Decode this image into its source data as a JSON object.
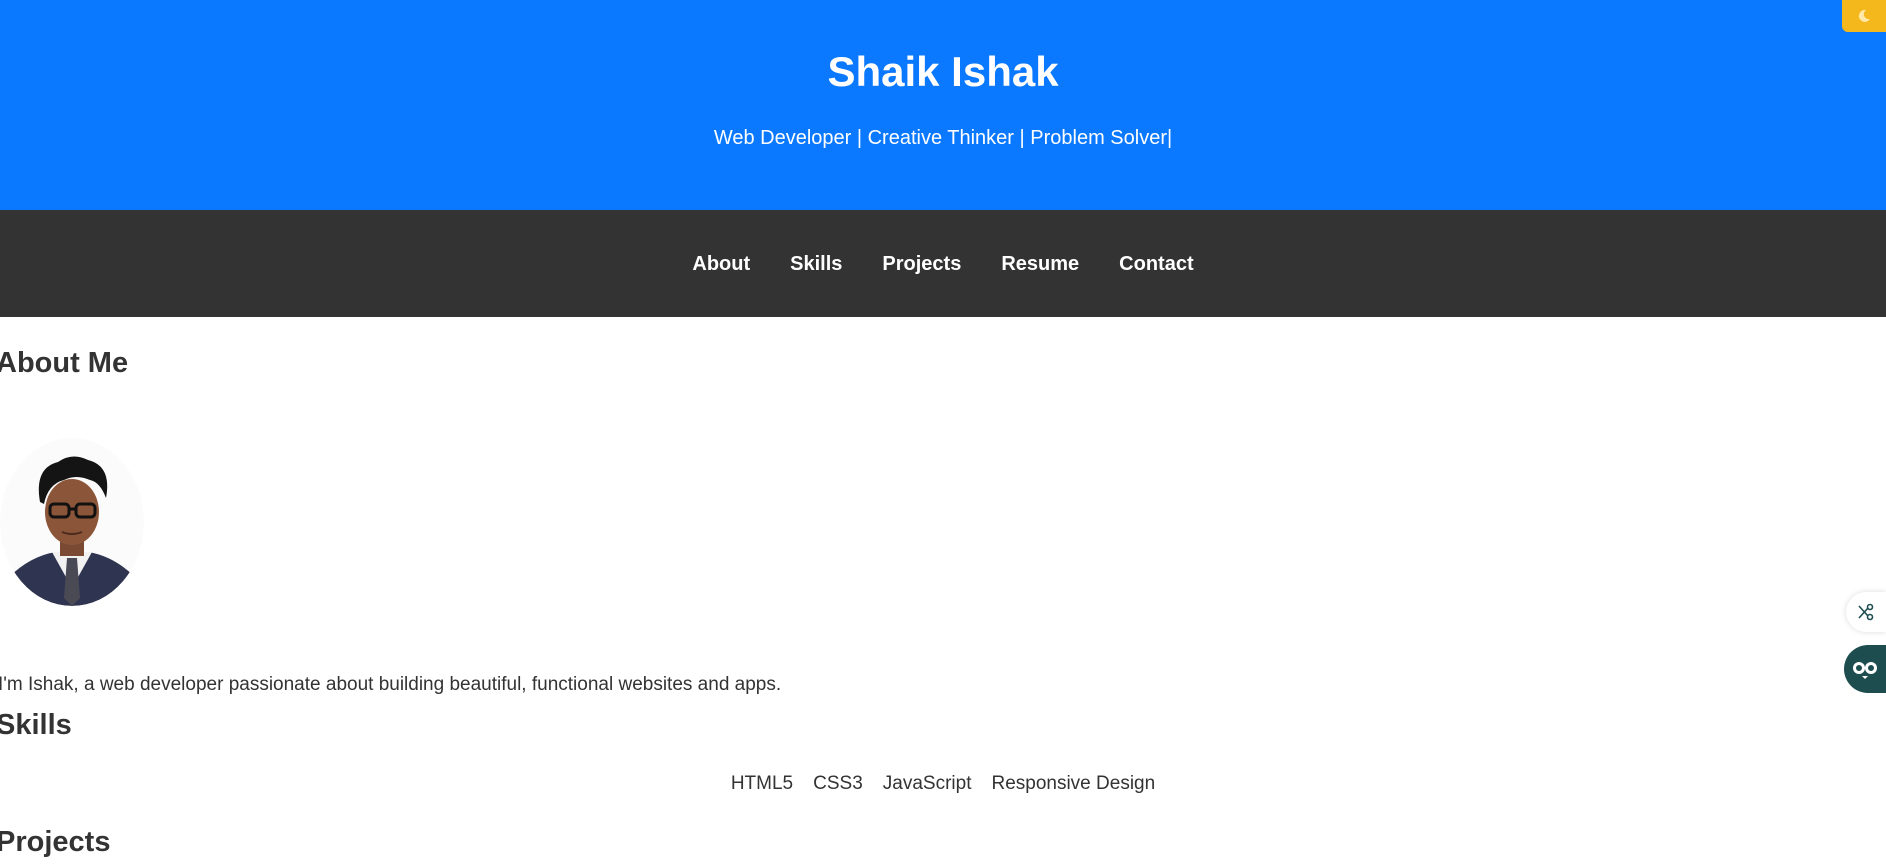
{
  "header": {
    "name": "Shaik Ishak",
    "tagline": "Web Developer | Creative Thinker | Problem Solver|"
  },
  "nav": {
    "items": [
      {
        "label": "About"
      },
      {
        "label": "Skills"
      },
      {
        "label": "Projects"
      },
      {
        "label": "Resume"
      },
      {
        "label": "Contact"
      }
    ]
  },
  "about": {
    "title": "About Me",
    "text": "I'm Ishak, a web developer passionate about building beautiful, functional websites and apps.",
    "avatar_icon": "profile-photo"
  },
  "skills": {
    "title": "Skills",
    "items": [
      "HTML5",
      "CSS3",
      "JavaScript",
      "Responsive Design"
    ]
  },
  "projects": {
    "title": "Projects"
  },
  "widgets": {
    "theme_toggle_icon": "moon-icon",
    "share_icon": "share-scissors-icon",
    "assistant_icon": "owl-icon"
  },
  "colors": {
    "header_bg": "#0a78ff",
    "nav_bg": "#333333",
    "toggle_bg": "#f5b81c",
    "owl_bg": "#1d4d4f"
  }
}
